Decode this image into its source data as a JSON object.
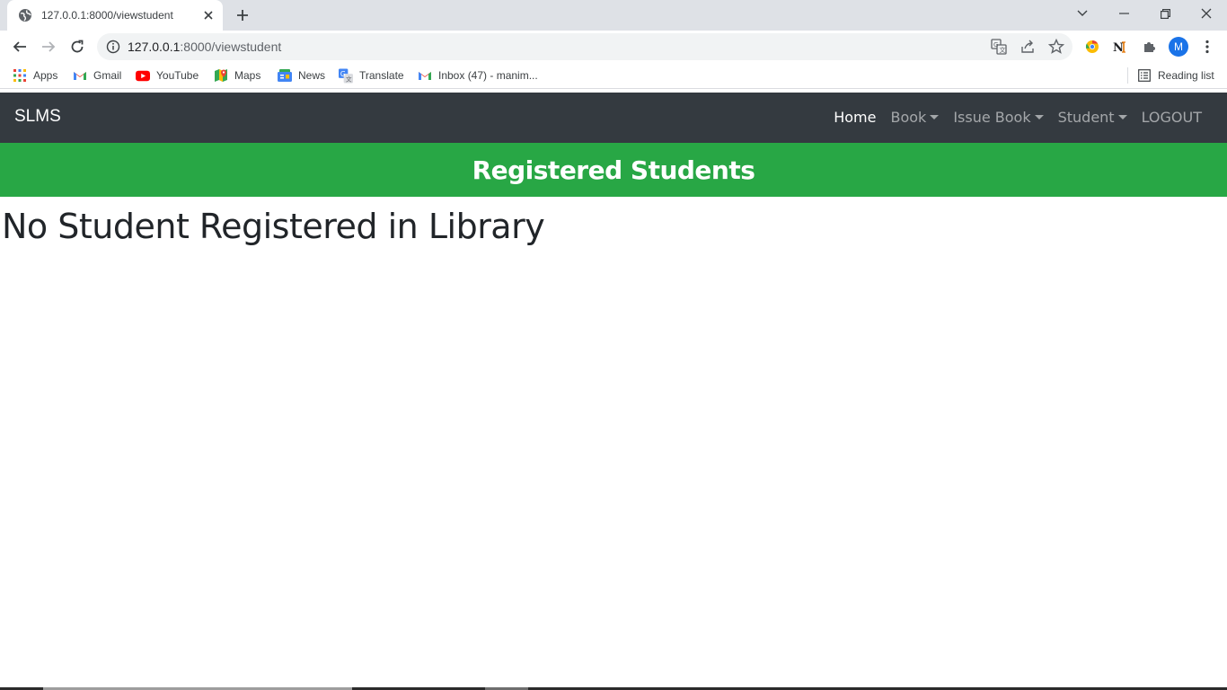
{
  "browser": {
    "tab": {
      "title": "127.0.0.1:8000/viewstudent",
      "icon": "globe-icon"
    },
    "url": {
      "host": "127.0.0.1",
      "path": ":8000/viewstudent"
    },
    "avatar_letter": "M",
    "bookmarks": [
      {
        "label": "Apps",
        "icon": "apps-grid-icon"
      },
      {
        "label": "Gmail",
        "icon": "gmail-icon"
      },
      {
        "label": "YouTube",
        "icon": "youtube-icon"
      },
      {
        "label": "Maps",
        "icon": "maps-icon"
      },
      {
        "label": "News",
        "icon": "news-icon"
      },
      {
        "label": "Translate",
        "icon": "translate-icon"
      },
      {
        "label": "Inbox (47) - manim...",
        "icon": "gmail-icon"
      }
    ],
    "reading_list": "Reading list"
  },
  "navbar": {
    "brand": "SLMS",
    "links": [
      {
        "label": "Home",
        "active": true,
        "dropdown": false
      },
      {
        "label": "Book",
        "active": false,
        "dropdown": true
      },
      {
        "label": "Issue Book",
        "active": false,
        "dropdown": true
      },
      {
        "label": "Student",
        "active": false,
        "dropdown": true
      },
      {
        "label": "LOGOUT",
        "active": false,
        "dropdown": false
      }
    ]
  },
  "banner": {
    "title": "Registered Students",
    "color": "#28a745"
  },
  "main": {
    "message": "No Student Registered in Library"
  },
  "colors": {
    "navbar_bg": "#343a40",
    "tabstrip_bg": "#dee1e6",
    "text": "#212529"
  }
}
